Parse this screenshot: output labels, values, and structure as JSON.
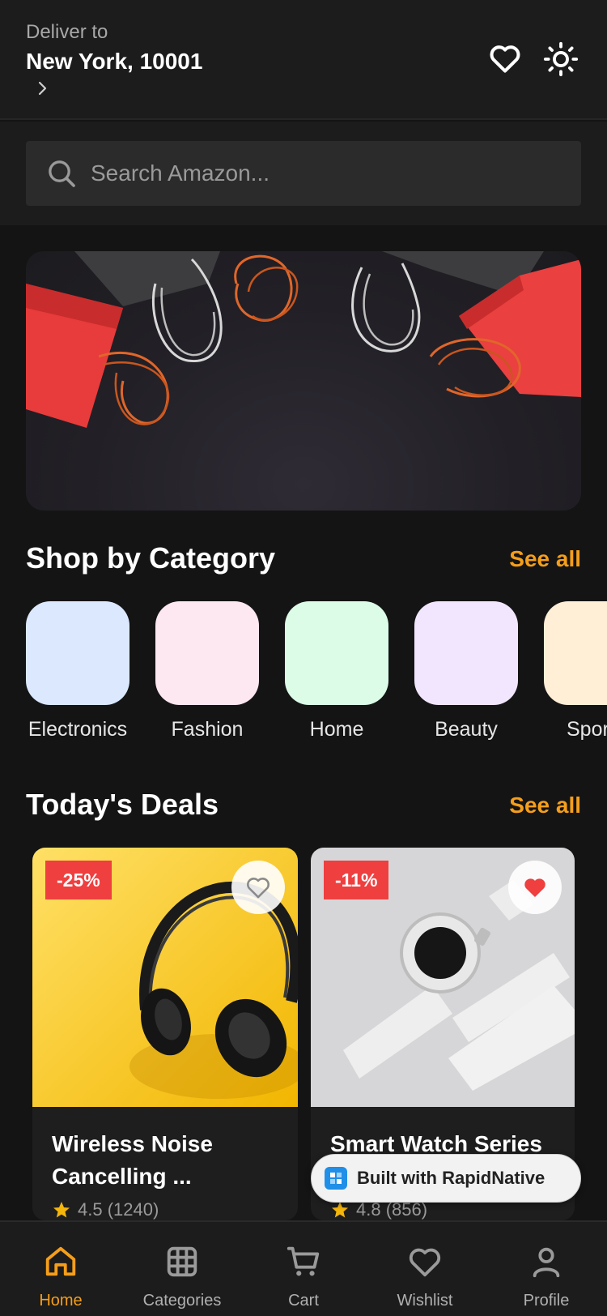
{
  "header": {
    "deliver_label": "Deliver to",
    "location": "New York, 10001"
  },
  "search": {
    "placeholder": "Search Amazon..."
  },
  "categories_section": {
    "title": "Shop by Category",
    "see_all": "See all",
    "items": [
      {
        "label": "Electronics",
        "color": "#dbe8fe"
      },
      {
        "label": "Fashion",
        "color": "#fde7f1"
      },
      {
        "label": "Home",
        "color": "#dcfce8"
      },
      {
        "label": "Beauty",
        "color": "#f2e6fe"
      },
      {
        "label": "Sports",
        "color": "#ffefd6"
      }
    ]
  },
  "deals_section": {
    "title": "Today's Deals",
    "see_all": "See all",
    "products": [
      {
        "discount": "-25%",
        "title": "Wireless Noise Cancelling ...",
        "rating": "4.5 (1240)",
        "favorited": false,
        "image": "headphones"
      },
      {
        "discount": "-11%",
        "title": "Smart Watch Series",
        "rating": "4.8 (856)",
        "favorited": true,
        "image": "smartwatch"
      }
    ]
  },
  "badge": {
    "text": "Built with RapidNative"
  },
  "tabbar": {
    "active_color": "#f59e1b",
    "tabs": [
      {
        "label": "Home",
        "icon": "home-icon",
        "active": true
      },
      {
        "label": "Categories",
        "icon": "grid-icon",
        "active": false
      },
      {
        "label": "Cart",
        "icon": "cart-icon",
        "active": false
      },
      {
        "label": "Wishlist",
        "icon": "heart-icon",
        "active": false
      },
      {
        "label": "Profile",
        "icon": "user-icon",
        "active": false
      }
    ]
  },
  "colors": {
    "accent": "#f59e1b",
    "discount": "#ef3f3f",
    "background": "#141414"
  }
}
